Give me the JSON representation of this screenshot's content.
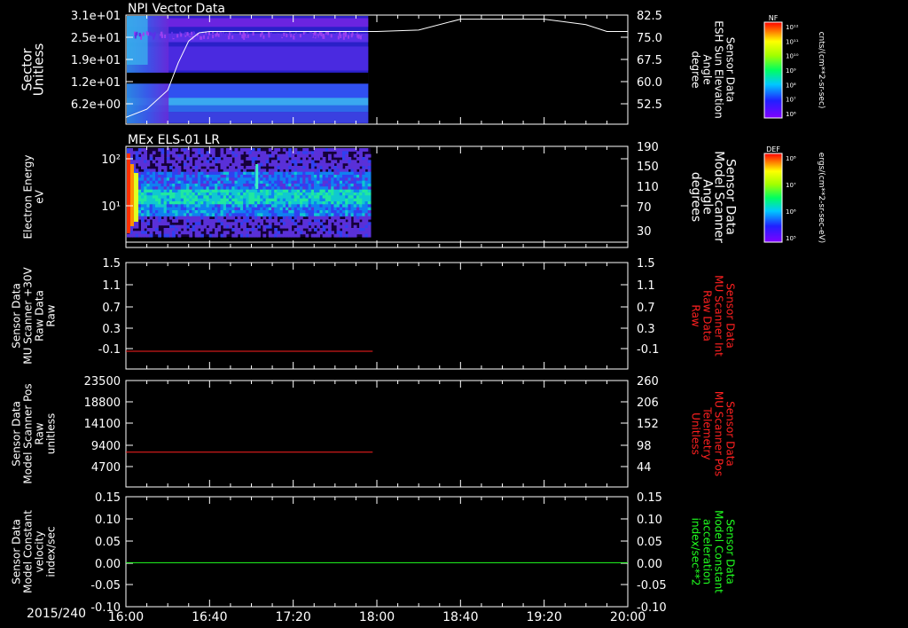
{
  "chart_data": {
    "type": "multi-panel timeseries",
    "date_label": "2015/240",
    "x_ticks": [
      "16:00",
      "16:40",
      "17:20",
      "18:00",
      "18:40",
      "19:20",
      "20:00"
    ],
    "data_end_time": "17:58",
    "panels": [
      {
        "id": "npi",
        "title": "NPI Vector Data",
        "kind": "spectrogram",
        "left_label": [
          "Sector",
          "Unitless"
        ],
        "left_ticks": [
          "3.1e+01",
          "2.5e+01",
          "1.9e+01",
          "1.2e+01",
          "6.2e+00"
        ],
        "right_label": [
          "Sensor Data",
          "ESH Sun Elevation",
          "Angle",
          "degree"
        ],
        "right_ticks": [
          "82.5",
          "75.0",
          "67.5",
          "60.0",
          "52.5"
        ],
        "overlay_line": {
          "name": "ESH Sun Elevation Angle",
          "x": [
            "16:00",
            "16:10",
            "16:20",
            "16:25",
            "16:30",
            "16:35",
            "16:40",
            "17:00",
            "17:30",
            "18:00",
            "18:20",
            "18:40",
            "19:00",
            "19:20",
            "19:40",
            "19:50",
            "20:00"
          ],
          "y": [
            45,
            48,
            55,
            65,
            73,
            76,
            76.5,
            76.5,
            76.5,
            76.5,
            77,
            81,
            81,
            81,
            79,
            76.5,
            76.5
          ]
        },
        "colorbar": {
          "label": "NF",
          "tick_labels": [
            "10¹²",
            "10¹¹",
            "10¹⁰",
            "10⁹",
            "10⁸",
            "10⁷",
            "10⁶"
          ],
          "units": "cnts/(cm**2-sr-sec)"
        }
      },
      {
        "id": "els",
        "title": "MEx ELS-01 LR",
        "kind": "spectrogram",
        "left_label": [
          "Electron Energy",
          "eV"
        ],
        "left_ticks": [
          "10²",
          "10¹"
        ],
        "right_label": [
          "Sensor Data",
          "Model Scanner",
          "Angle",
          "degrees"
        ],
        "right_ticks": [
          "190",
          "150",
          "110",
          "70",
          "30"
        ],
        "overlay_line": {
          "name": "Model Scanner Angle",
          "x": [
            "16:00",
            "20:00"
          ],
          "y": [
            10,
            10
          ]
        },
        "colorbar": {
          "label": "DEF",
          "tick_labels": [
            "10⁸",
            "10⁷",
            "10⁶",
            "10⁵"
          ],
          "units": "ergs/(cm**2-sr-sec-eV)"
        }
      },
      {
        "id": "mu30",
        "kind": "line",
        "left_label": [
          "Sensor Data",
          "MU Scanner +30V",
          "Raw Data",
          "Raw"
        ],
        "left_ticks": [
          "1.5",
          "1.1",
          "0.7",
          "0.3",
          "-0.1"
        ],
        "right_label": [
          "Sensor Data",
          "MU Scanner Int",
          "Raw Data",
          "Raw"
        ],
        "right_ticks": [
          "1.5",
          "1.1",
          "0.7",
          "0.3",
          "-0.1"
        ],
        "right_label_color": "#ff2020",
        "series": [
          {
            "name": "MU Scanner Int",
            "color": "#ff2020",
            "x": [
              "16:00",
              "17:58"
            ],
            "y": [
              0.0,
              0.0
            ]
          }
        ]
      },
      {
        "id": "pos",
        "kind": "line",
        "left_label": [
          "Sensor Data",
          "Model Scanner Pos",
          "Raw",
          "unitless"
        ],
        "left_ticks": [
          "23500",
          "18800",
          "14100",
          "9400",
          "4700"
        ],
        "right_label": [
          "Sensor Data",
          "MU Scanner Pos",
          "Telemetry",
          "Unitless"
        ],
        "right_ticks": [
          "260",
          "206",
          "152",
          "98",
          "44"
        ],
        "right_label_color": "#ff2020",
        "series": [
          {
            "name": "MU Scanner Pos",
            "color": "#ff2020",
            "x": [
              "16:00",
              "17:58"
            ],
            "y": [
              7700,
              7700
            ]
          }
        ]
      },
      {
        "id": "vel",
        "kind": "line",
        "left_label": [
          "Sensor Data",
          "Model Constant",
          "velocity",
          "index/sec"
        ],
        "left_ticks": [
          "0.15",
          "0.10",
          "0.05",
          "0.00",
          "-0.05",
          "-0.10"
        ],
        "right_label": [
          "Sensor Data",
          "Model Constant",
          "acceleration",
          "index/sec**2"
        ],
        "right_ticks": [
          "0.15",
          "0.10",
          "0.05",
          "0.00",
          "-0.05",
          "-0.10"
        ],
        "right_label_color": "#20ff20",
        "series": [
          {
            "name": "Model Constant acceleration",
            "color": "#20ff20",
            "x": [
              "16:00",
              "20:00"
            ],
            "y": [
              0.0,
              0.0
            ]
          }
        ]
      }
    ]
  }
}
